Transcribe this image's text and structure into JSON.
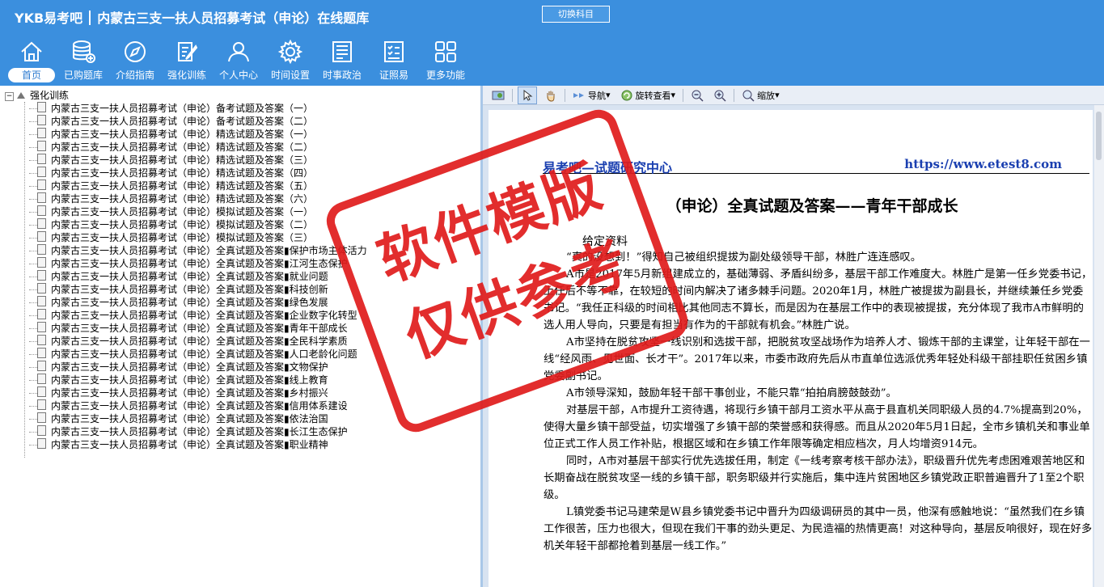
{
  "app": {
    "logo": "YKB易考吧",
    "title": "内蒙古三支一扶人员招募考试（申论）在线题库",
    "switch_label": "切换科目"
  },
  "nav": [
    {
      "label": "首页",
      "icon": "home-icon"
    },
    {
      "label": "已购题库",
      "icon": "database-icon"
    },
    {
      "label": "介绍指南",
      "icon": "compass-icon"
    },
    {
      "label": "强化训练",
      "icon": "edit-icon"
    },
    {
      "label": "个人中心",
      "icon": "user-icon"
    },
    {
      "label": "时间设置",
      "icon": "gear-icon"
    },
    {
      "label": "时事政治",
      "icon": "news-icon"
    },
    {
      "label": "证照易",
      "icon": "checklist-icon"
    },
    {
      "label": "更多功能",
      "icon": "grid-icon"
    }
  ],
  "tree": {
    "root": "强化训练",
    "items": [
      "内蒙古三支一扶人员招募考试（申论）备考试题及答案（一）",
      "内蒙古三支一扶人员招募考试（申论）备考试题及答案（二）",
      "内蒙古三支一扶人员招募考试（申论）精选试题及答案（一）",
      "内蒙古三支一扶人员招募考试（申论）精选试题及答案（二）",
      "内蒙古三支一扶人员招募考试（申论）精选试题及答案（三）",
      "内蒙古三支一扶人员招募考试（申论）精选试题及答案（四）",
      "内蒙古三支一扶人员招募考试（申论）精选试题及答案（五）",
      "内蒙古三支一扶人员招募考试（申论）精选试题及答案（六）",
      "内蒙古三支一扶人员招募考试（申论）模拟试题及答案（一）",
      "内蒙古三支一扶人员招募考试（申论）模拟试题及答案（二）",
      "内蒙古三支一扶人员招募考试（申论）模拟试题及答案（三）",
      "内蒙古三支一扶人员招募考试（申论）全真试题及答案▮保护市场主体活力",
      "内蒙古三支一扶人员招募考试（申论）全真试题及答案▮江河生态保护",
      "内蒙古三支一扶人员招募考试（申论）全真试题及答案▮就业问题",
      "内蒙古三支一扶人员招募考试（申论）全真试题及答案▮科技创新",
      "内蒙古三支一扶人员招募考试（申论）全真试题及答案▮绿色发展",
      "内蒙古三支一扶人员招募考试（申论）全真试题及答案▮企业数字化转型",
      "内蒙古三支一扶人员招募考试（申论）全真试题及答案▮青年干部成长",
      "内蒙古三支一扶人员招募考试（申论）全真试题及答案▮全民科学素质",
      "内蒙古三支一扶人员招募考试（申论）全真试题及答案▮人口老龄化问题",
      "内蒙古三支一扶人员招募考试（申论）全真试题及答案▮文物保护",
      "内蒙古三支一扶人员招募考试（申论）全真试题及答案▮线上教育",
      "内蒙古三支一扶人员招募考试（申论）全真试题及答案▮乡村振兴",
      "内蒙古三支一扶人员招募考试（申论）全真试题及答案▮信用体系建设",
      "内蒙古三支一扶人员招募考试（申论）全真试题及答案▮依法治国",
      "内蒙古三支一扶人员招募考试（申论）全真试题及答案▮长江生态保护",
      "内蒙古三支一扶人员招募考试（申论）全真试题及答案▮职业精神"
    ]
  },
  "viewer_toolbar": {
    "nav_label": "导航",
    "rotate_label": "旋转查看",
    "zoom_label": "缩放"
  },
  "document": {
    "header_left": "易考吧—试题研究中心",
    "header_right": "https://www.etest8.com",
    "title": "（申论）全真试题及答案——青年干部成长",
    "section": "给定资料",
    "paragraphs": [
      "“真的没想到！”得知自己被组织提拔为副处级领导干部，林胜广连连感叹。",
      "A市是2017年5月新组建成立的，基础薄弱、矛盾纠纷多，基层干部工作难度大。林胜广是第一任乡党委书记，上任后不等不靠，在较短的时间内解决了诸多棘手问题。2020年1月，林胜广被提拔为副县长，并继续兼任乡党委书记。“我任正科级的时间相比其他同志不算长，而是因为在基层工作中的表现被提拔，充分体现了我市A市鲜明的选人用人导向，只要是有担当有作为的干部就有机会。”林胜广说。",
      "A市坚持在脱贫攻坚一线识别和选拔干部，把脱贫攻坚战场作为培养人才、锻炼干部的主课堂，让年轻干部在一线“经风雨、见世面、长才干”。2017年以来，市委市政府先后从市直单位选派优秀年轻处科级干部挂职任贫困乡镇党委副书记。",
      "A市领导深知，鼓励年轻干部干事创业，不能只靠“拍拍肩膀鼓鼓劲”。",
      "对基层干部，A市提升工资待遇，将现行乡镇干部月工资水平从高于县直机关同职级人员的4.7%提高到20%，使得大量乡镇干部受益，切实增强了乡镇干部的荣誉感和获得感。而且从2020年5月1日起，全市乡镇机关和事业单位正式工作人员工作补贴，根据区域和在乡镇工作年限等确定相应档次，月人均增资914元。",
      "同时，A市对基层干部实行优先选拔任用，制定《一线考察考核干部办法》，职级晋升优先考虑困难艰苦地区和长期奋战在脱贫攻坚一线的乡镇干部，职务职级并行实施后，集中连片贫困地区乡镇党政正职普遍晋升了1至2个职级。",
      "L镇党委书记马建荣是W县乡镇党委书记中晋升为四级调研员的其中一员，他深有感触地说：“虽然我们在乡镇工作很苦，压力也很大，但现在我们干事的劲头更足、为民造福的热情更高！对这种导向，基层反响很好，现在好多机关年轻干部都抢着到基层一线工作。”"
    ]
  },
  "watermark": {
    "line1": "软件模版",
    "line2": "仅供参考"
  }
}
